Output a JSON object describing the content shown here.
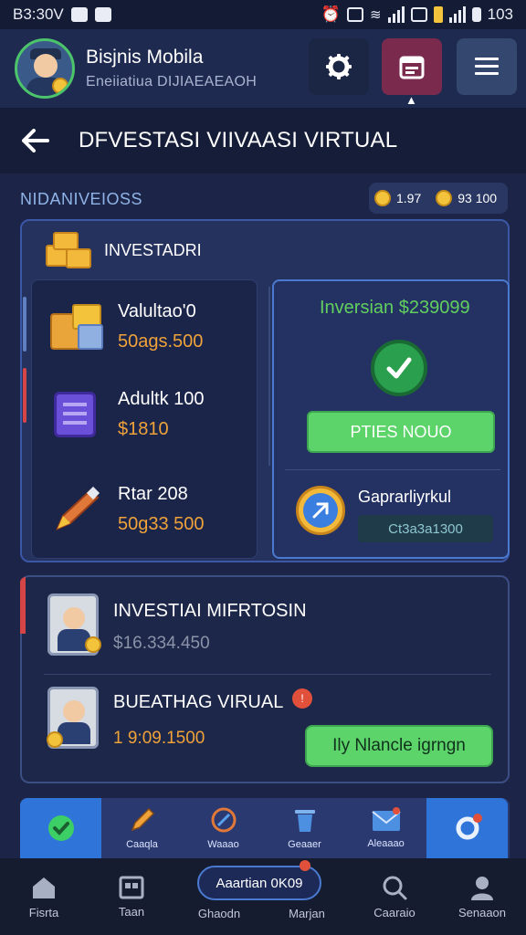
{
  "status_bar": {
    "time": "B3:30V",
    "battery_text": "103"
  },
  "header": {
    "app_name": "Bisjnis Mobila",
    "subtitle": "Eneiiatiua DIJIAEAEAOH"
  },
  "page": {
    "title": "DFVESTASI VIIVAASI VIRTUAL"
  },
  "section": {
    "label": "NIDANIVEIOSS",
    "balance_1": "1.97",
    "balance_2": "93 100"
  },
  "invest_card": {
    "title": "INVESTADRI",
    "items": [
      {
        "name": "Valultao'0",
        "amount": "50ags.500"
      },
      {
        "name": "Adultk 100",
        "amount": "$1810"
      },
      {
        "name": "Rtar 208",
        "amount": "50g33 500"
      }
    ],
    "right": {
      "title": "Inversian $239099",
      "button_label": "PTIES NOUO",
      "payment_label": "Gaprarliyrkul",
      "payment_code": "Ct3a3a1300"
    }
  },
  "second_card": {
    "row1_title": "INVESTIAI MIFRTOSIN",
    "row1_amount": "$16.334.450",
    "row2_title": "BUEATHAG VIRUAL",
    "row2_amount": "1 9:09.1500",
    "button_label": "Ily Nlancle igrngn"
  },
  "tool_strip": {
    "items": [
      {
        "label": ""
      },
      {
        "label": "Caaqla"
      },
      {
        "label": "Waaao"
      },
      {
        "label": "Geaaer"
      },
      {
        "label": "Aleaaao"
      },
      {
        "label": ""
      }
    ]
  },
  "bottom_nav": {
    "items": [
      {
        "label": "Fisrta"
      },
      {
        "label": "Taan"
      },
      {
        "label": "Ghaodn"
      },
      {
        "label": "Marjan"
      },
      {
        "label": "Caaraio"
      },
      {
        "label": "Senaaon"
      }
    ],
    "pill_label": "Aaartian 0K09"
  },
  "colors": {
    "accent_green": "#5cd46a",
    "accent_blue": "#2f74d8",
    "amount_orange": "#f0a23a",
    "background": "#1c2547"
  }
}
